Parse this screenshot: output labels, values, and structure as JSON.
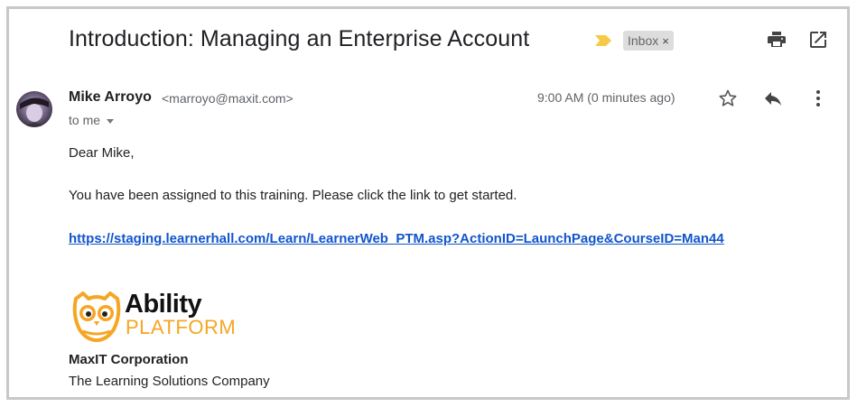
{
  "email": {
    "subject": "Introduction: Managing an Enterprise Account",
    "label": "Inbox",
    "label_remove": "×",
    "importance_color": "#f7c948",
    "sender": {
      "name": "Mike Arroyo",
      "email": "<marroyo@maxit.com>"
    },
    "recipient_text": "to me",
    "timestamp": "9:00 AM (0 minutes ago)",
    "icons": {
      "print": "printer-icon",
      "popout": "open-in-new-window-icon",
      "star": "star-icon",
      "reply": "reply-icon",
      "more": "more-options-icon"
    },
    "body": {
      "greeting": "Dear Mike,",
      "message": "You have been assigned to this training. Please click the link to get started.",
      "link": "https://staging.learnerhall.com/Learn/LearnerWeb_PTM.asp?ActionID=LaunchPage&CourseID=Man44 "
    },
    "signature": {
      "logo_line1": "Ability",
      "logo_line2": "PLATFORM",
      "company": "MaxIT Corporation",
      "tagline": "The Learning Solutions Company"
    }
  },
  "colors": {
    "link": "#1155cc",
    "logo_accent": "#f5a623",
    "icon": "#444444"
  }
}
